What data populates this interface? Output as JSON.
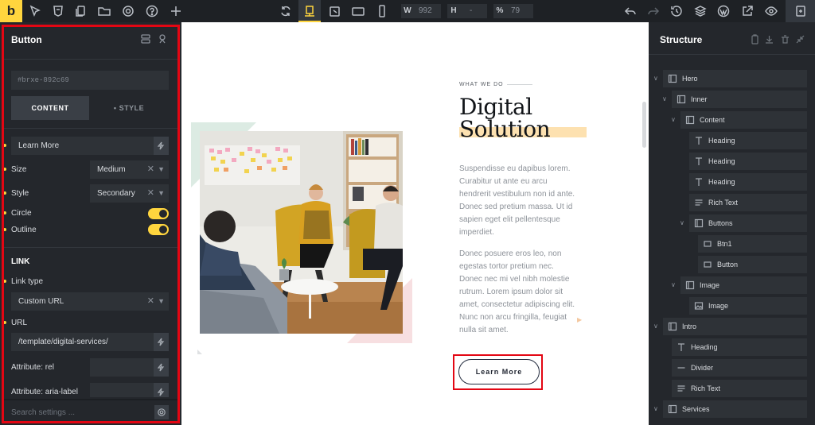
{
  "topbar": {
    "logo": "b",
    "width_label": "W",
    "width_value": "992",
    "height_label": "H",
    "height_value": "-",
    "percent_label": "%",
    "percent_value": "79"
  },
  "left_panel": {
    "title": "Button",
    "element_id": "#brxe-892c69",
    "tabs": {
      "content": "CONTENT",
      "style": "• STYLE"
    },
    "text_value": "Learn More",
    "size": {
      "label": "Size",
      "value": "Medium"
    },
    "style": {
      "label": "Style",
      "value": "Secondary"
    },
    "circle_label": "Circle",
    "outline_label": "Outline",
    "link_section": "LINK",
    "link_type": {
      "label": "Link type",
      "value": "Custom URL"
    },
    "url": {
      "label": "URL",
      "value": "/template/digital-services/"
    },
    "attr_rel_label": "Attribute: rel",
    "attr_aria_label": "Attribute: aria-label",
    "search_placeholder": "Search settings ..."
  },
  "canvas": {
    "kicker": "WHAT WE DO",
    "heading_line1": "Digital",
    "heading_line2": "Solution",
    "paragraph1": [
      "Suspendisse eu dapibus lorem.",
      "Curabitur ut ante eu arcu",
      "hendrerit vestibulum non id ante.",
      "Donec sed pretium massa. Ut id",
      "sapien eget elit pellentesque",
      "imperdiet."
    ],
    "paragraph2": [
      "Donec posuere eros leo, non",
      "egestas tortor pretium nec.",
      "Donec nec mi vel nibh molestie",
      "rutrum. Lorem ipsum dolor sit",
      "amet, consectetur adipiscing elit.",
      "Nunc non arcu fringilla, feugiat",
      "nulla sit amet."
    ],
    "button_label": "Learn More"
  },
  "structure_panel": {
    "title": "Structure",
    "items": [
      {
        "label": "Hero",
        "icon": "section-icon"
      },
      {
        "label": "Inner",
        "icon": "container-icon"
      },
      {
        "label": "Content",
        "icon": "container-icon"
      },
      {
        "label": "Heading",
        "icon": "heading-icon"
      },
      {
        "label": "Heading",
        "icon": "heading-icon"
      },
      {
        "label": "Heading",
        "icon": "heading-icon"
      },
      {
        "label": "Rich Text",
        "icon": "rich-text-icon"
      },
      {
        "label": "Buttons",
        "icon": "container-icon"
      },
      {
        "label": "Btn1",
        "icon": "button-icon"
      },
      {
        "label": "Button",
        "icon": "button-icon"
      },
      {
        "label": "Image",
        "icon": "container-icon"
      },
      {
        "label": "Image",
        "icon": "image-icon"
      },
      {
        "label": "Intro",
        "icon": "section-icon"
      },
      {
        "label": "Heading",
        "icon": "heading-icon"
      },
      {
        "label": "Divider",
        "icon": "divider-icon"
      },
      {
        "label": "Rich Text",
        "icon": "rich-text-icon"
      },
      {
        "label": "Services",
        "icon": "section-icon"
      }
    ]
  },
  "colors": {
    "accent": "#ffd53e",
    "panel_bg": "#24272c",
    "highlight": "#e30613",
    "heading_highlight": "#fde1b0"
  }
}
